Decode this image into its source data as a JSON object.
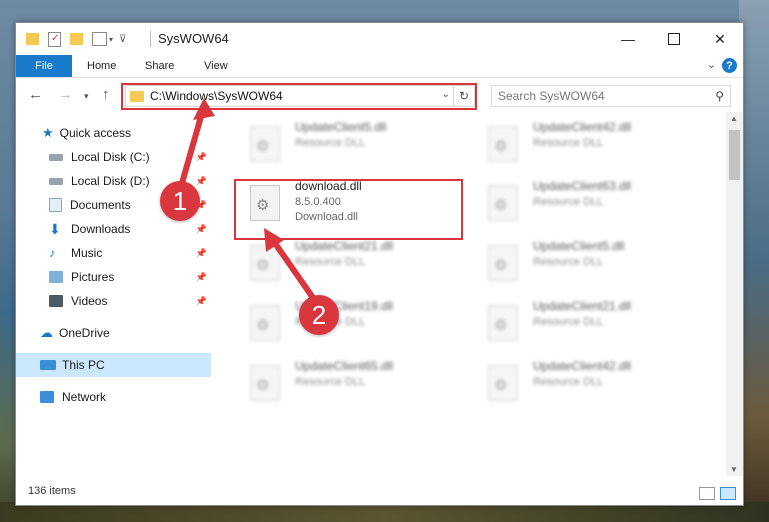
{
  "window": {
    "title": "SysWOW64"
  },
  "ribbon": {
    "tabs": [
      "File",
      "Home",
      "Share",
      "View"
    ],
    "help": "?"
  },
  "nav": {
    "address": "C:\\Windows\\SysWOW64",
    "search_placeholder": "Search SysWOW64"
  },
  "sidebar": {
    "items": [
      {
        "label": "Quick access",
        "icon": "star-icon"
      },
      {
        "label": "Local Disk (C:)",
        "icon": "drive-icon"
      },
      {
        "label": "Local Disk (D:)",
        "icon": "drive-icon"
      },
      {
        "label": "Documents",
        "icon": "documents-icon"
      },
      {
        "label": "Downloads",
        "icon": "download-arrow-icon"
      },
      {
        "label": "Music",
        "icon": "music-icon"
      },
      {
        "label": "Pictures",
        "icon": "pictures-icon"
      },
      {
        "label": "Videos",
        "icon": "videos-icon"
      },
      {
        "label": "OneDrive",
        "icon": "cloud-icon"
      },
      {
        "label": "This PC",
        "icon": "computer-icon"
      },
      {
        "label": "Network",
        "icon": "network-icon"
      }
    ]
  },
  "files": {
    "highlighted": {
      "name": "download.dll",
      "version": "8.5.0.400",
      "description": "Download.dll"
    },
    "blurred": [
      {
        "name": "UpdateClient5.dll",
        "description": "Resource DLL"
      },
      {
        "name": "UpdateClient42.dll",
        "description": "Resource DLL"
      },
      {
        "name": "UpdateClient63.dll",
        "description": "Resource DLL"
      },
      {
        "name": "UpdateClient21.dll",
        "description": "Resource DLL"
      },
      {
        "name": "UpdateClient5.dll",
        "description": "Resource DLL"
      },
      {
        "name": "UpdateClient19.dll",
        "description": "Resource DLL"
      },
      {
        "name": "UpdateClient21.dll",
        "description": "Resource DLL"
      },
      {
        "name": "UpdateClient65.dll",
        "description": "Resource DLL"
      },
      {
        "name": "UpdateClient42.dll",
        "description": "Resource DLL"
      }
    ]
  },
  "status": {
    "items_count": "136 items"
  },
  "annotations": {
    "step1": "1",
    "step2": "2",
    "color": "#d9363e"
  }
}
